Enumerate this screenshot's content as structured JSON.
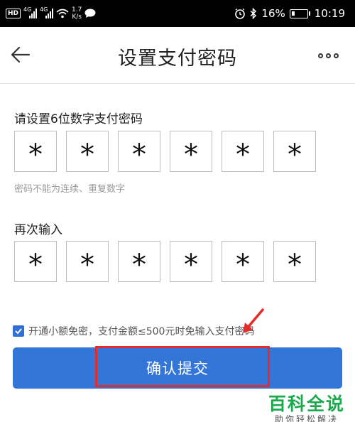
{
  "status_bar": {
    "hd_label": "HD",
    "network_1": "4G",
    "network_2": "4G",
    "speed_value": "1.7",
    "speed_unit": "K/s",
    "battery_percent": "16%",
    "time": "10:19"
  },
  "header": {
    "title": "设置支付密码"
  },
  "pin_section": {
    "label": "请设置6位数字支付密码",
    "digits": [
      "*",
      "*",
      "*",
      "*",
      "*",
      "*"
    ],
    "hint": "密码不能为连续、重复数字"
  },
  "confirm_section": {
    "label": "再次输入",
    "digits": [
      "*",
      "*",
      "*",
      "*",
      "*",
      "*"
    ]
  },
  "agreement": {
    "checked": true,
    "text": "开通小额免密，支付金额≤500元时免输入支付密码"
  },
  "confirm_button": {
    "label": "确认提交"
  },
  "watermark": {
    "title": "百科全说",
    "subtitle": "助你轻松解决"
  },
  "colors": {
    "accent": "#3376d8",
    "highlight": "#e52a2a",
    "watermark": "#1aa94c"
  }
}
